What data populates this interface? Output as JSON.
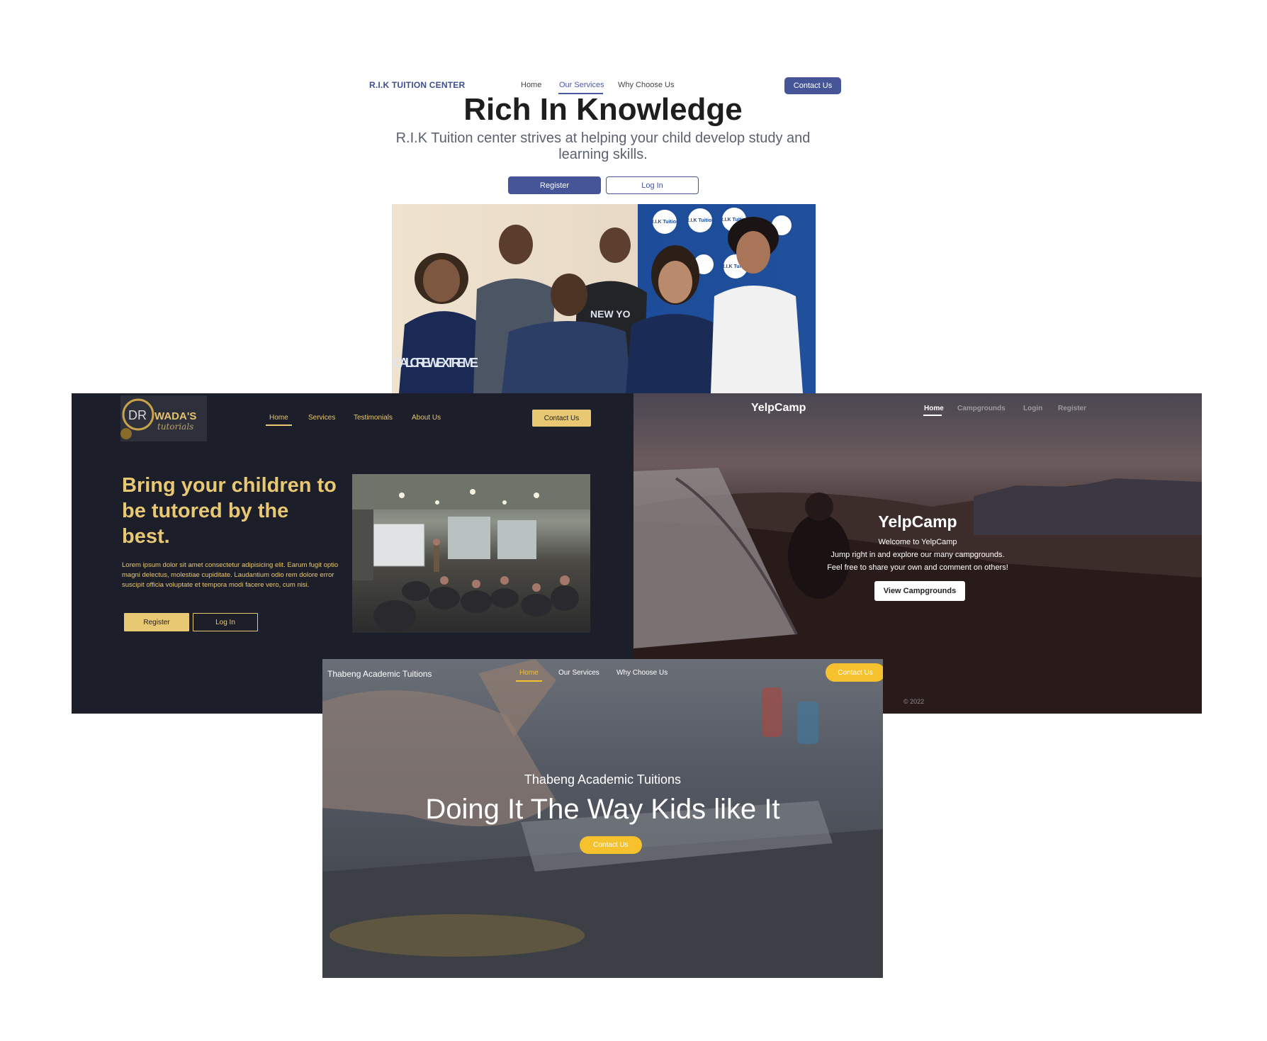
{
  "rik": {
    "brand": "R.I.K TUITION CENTER",
    "nav": [
      "Home",
      "Our Services",
      "Why Choose Us"
    ],
    "contact": "Contact Us",
    "title": "Rich In Knowledge",
    "subtitle": "R.I.K Tuition center strives at helping your child develop study and learning skills.",
    "register": "Register",
    "login": "Log In",
    "photo": {
      "shirt_text": "NEW YO",
      "hoodie_text": "CAL CREW EXTREME",
      "logo_text": "R.I.K Tuition"
    }
  },
  "wada": {
    "logo": {
      "prefix": "DR",
      "name": "WADA'S",
      "script": "tutorials"
    },
    "nav": [
      "Home",
      "Services",
      "Testimonials",
      "About Us"
    ],
    "contact": "Contact Us",
    "title": "Bring your children to be tutored by the best.",
    "body": "Lorem ipsum dolor sit amet consectetur adipisicing elit. Earum fugit optio magni delectus, molestiae cupiditate. Laudantium odio rem dolore error suscipit officia voluptate et tempora modi facere vero, cum nisi.",
    "register": "Register",
    "login": "Log In"
  },
  "yelp": {
    "brand": "YelpCamp",
    "nav": [
      "Home",
      "Campgrounds",
      "Login",
      "Register"
    ],
    "heading": "YelpCamp",
    "welcome": "Welcome to YelpCamp",
    "line1": "Jump right in and explore our many campgrounds.",
    "line2": "Feel free to share your own and comment on others!",
    "button": "View Campgrounds",
    "footer": "© 2022"
  },
  "thabeng": {
    "brand": "Thabeng Academic Tuitions",
    "nav": [
      "Home",
      "Our Services",
      "Why Choose Us"
    ],
    "contact": "Contact Us",
    "subtitle": "Thabeng Academic Tuitions",
    "title": "Doing It The Way Kids like It",
    "button": "Contact Us"
  },
  "colors": {
    "rik_accent": "#465597",
    "wada_bg": "#1c1e2a",
    "wada_gold": "#e8c872",
    "thabeng_yellow": "#f5c12c"
  }
}
